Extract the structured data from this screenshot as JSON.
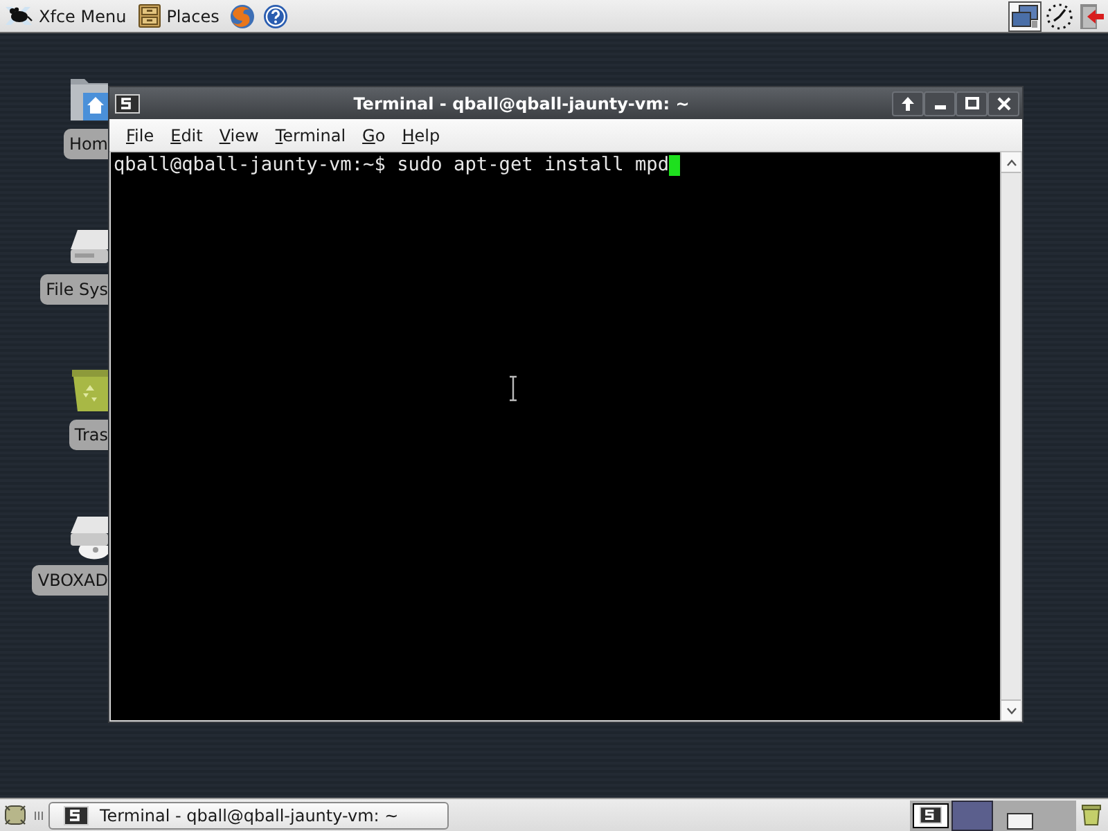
{
  "top_panel": {
    "menu_label": "Xfce Menu",
    "places_label": "Places"
  },
  "desktop_icons": [
    {
      "kind": "home-folder",
      "label": "Hom"
    },
    {
      "kind": "drive",
      "label": "File Sys"
    },
    {
      "kind": "trash",
      "label": "Tras"
    },
    {
      "kind": "optical-drive",
      "label": "VBOXAD"
    }
  ],
  "window": {
    "title": "Terminal - qball@qball-jaunty-vm: ~",
    "menu": [
      "File",
      "Edit",
      "View",
      "Terminal",
      "Go",
      "Help"
    ],
    "terminal_line": "qball@qball-jaunty-vm:~$ sudo apt-get install mpd"
  },
  "taskbar": {
    "tasks": [
      {
        "title": "Terminal - qball@qball-jaunty-vm: ~"
      }
    ]
  },
  "workspaces": [
    {
      "selected": false,
      "kind": "app-window"
    },
    {
      "selected": true,
      "kind": "empty"
    },
    {
      "selected": false,
      "kind": "blank-window"
    },
    {
      "selected": false,
      "kind": "empty"
    }
  ]
}
